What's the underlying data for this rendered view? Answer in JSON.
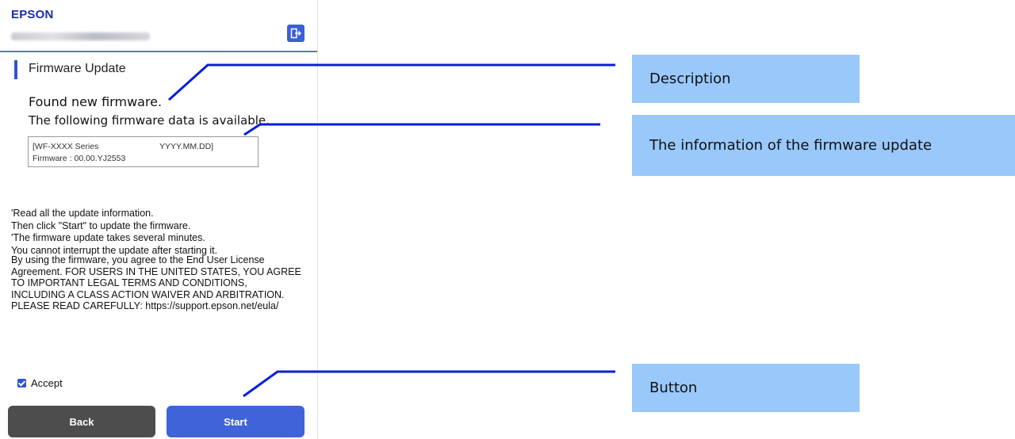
{
  "header": {
    "logo": "EPSON",
    "logout_icon": "logout-icon"
  },
  "page": {
    "title": "Firmware Update",
    "found": "Found new firmware.",
    "following": "The following firmware data is available.",
    "firmware_box": {
      "series": "[WF-XXXX Series",
      "date": "YYYY.MM.DD]",
      "firmware": "Firmware : 00.00.YJ2553"
    },
    "instructions": "'Read all the update information.\nThen click \"Start\" to update the firmware.\n'The firmware update takes several minutes.\nYou cannot interrupt the update after starting it.",
    "eula": "By using the firmware, you agree to the End User License\nAgreement. FOR USERS IN THE UNITED STATES, YOU AGREE\nTO IMPORTANT LEGAL TERMS AND CONDITIONS,\nINCLUDING A CLASS ACTION WAIVER AND ARBITRATION.\nPLEASE READ CAREFULLY: https://support.epson.net/eula/",
    "accept_label": "Accept",
    "accept_checked": true,
    "back_label": "Back",
    "start_label": "Start"
  },
  "callouts": {
    "description": "Description",
    "info": "The information of the firmware update",
    "button": "Button"
  },
  "colors": {
    "brand": "#1b2fa8",
    "accent": "#3f63d8",
    "back_button": "#4d4d4d",
    "callout_bg": "#99c9fb",
    "leader_line": "#0a1fd6"
  }
}
